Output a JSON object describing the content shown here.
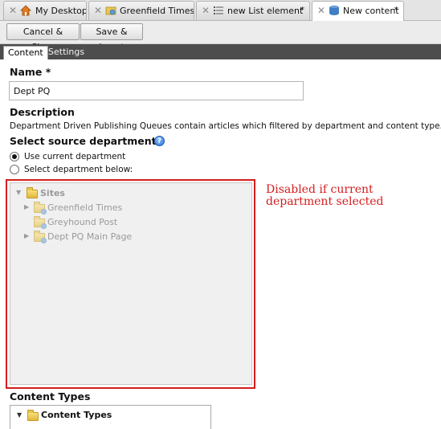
{
  "tabs": [
    {
      "label": "My Desktop",
      "modified": "",
      "icon": "house-icon"
    },
    {
      "label": "Greenfield Times",
      "modified": "",
      "icon": "site-icon"
    },
    {
      "label": "new List element",
      "modified": "*",
      "icon": "list-icon"
    },
    {
      "label": "New content",
      "modified": "*",
      "icon": "database-icon"
    }
  ],
  "tab_close_glyph": "✕",
  "toolbar": {
    "cancel_label": "Cancel & Close",
    "save_label": "Save & Insert"
  },
  "subtabs": {
    "content": "Content",
    "settings": "Settings"
  },
  "form": {
    "name_label": "Name *",
    "name_value": "Dept PQ",
    "description_label": "Description",
    "description_text": "Department Driven Publishing Queues contain articles which filtered by department and content type.",
    "source_label": "Select source department",
    "help_glyph": "?",
    "radio_current": "Use current department",
    "radio_select": "Select department below:",
    "content_types_label": "Content Types"
  },
  "tree": {
    "root": "Sites",
    "children": [
      "Greenfield Times",
      "Greyhound Post",
      "Dept PQ Main Page"
    ]
  },
  "content_types_tree": {
    "root": "Content Types"
  },
  "annotation": {
    "line1": "Disabled if current",
    "line2": "department selected"
  },
  "colors": {
    "annotation_red": "#d51d1d",
    "subtab_bar": "#4d4d4d"
  }
}
